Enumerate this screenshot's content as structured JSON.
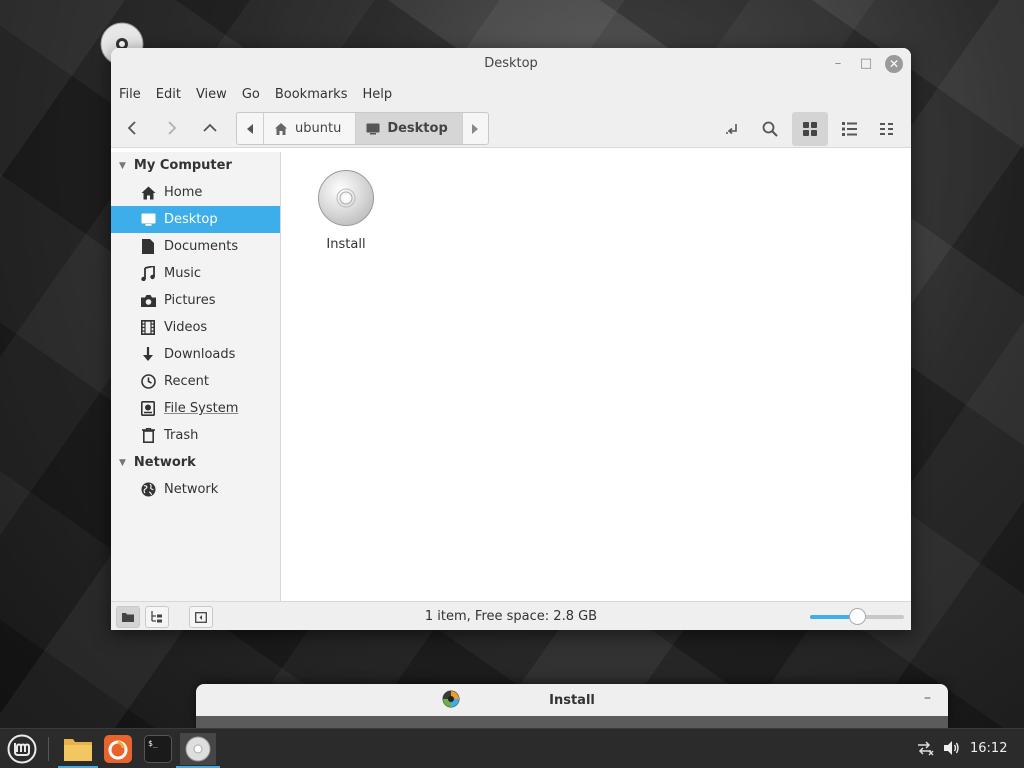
{
  "desktop": {
    "icon_label": "Install"
  },
  "window": {
    "title": "Desktop",
    "controls": {
      "minimize": "–",
      "maximize": "□",
      "close": "✕"
    }
  },
  "menubar": [
    "File",
    "Edit",
    "Go",
    "Bookmarks",
    "Help"
  ],
  "pathbar": {
    "crumbs": [
      {
        "label": "ubuntu",
        "icon": "home-icon"
      },
      {
        "label": "Desktop",
        "icon": "desktop-icon"
      }
    ]
  },
  "sidebar": {
    "sections": [
      {
        "title": "My Computer",
        "items": [
          {
            "label": "Home",
            "icon": "home-icon"
          },
          {
            "label": "Desktop",
            "icon": "desktop-icon",
            "selected": true
          },
          {
            "label": "Documents",
            "icon": "document-icon"
          },
          {
            "label": "Music",
            "icon": "music-icon"
          },
          {
            "label": "Pictures",
            "icon": "camera-icon"
          },
          {
            "label": "Videos",
            "icon": "film-icon"
          },
          {
            "label": "Downloads",
            "icon": "download-icon"
          },
          {
            "label": "Recent",
            "icon": "clock-icon"
          },
          {
            "label": "File System",
            "icon": "drive-icon"
          },
          {
            "label": "Trash",
            "icon": "trash-icon"
          }
        ]
      },
      {
        "title": "Network",
        "items": [
          {
            "label": "Network",
            "icon": "globe-icon"
          }
        ]
      }
    ]
  },
  "files": [
    {
      "label": "Install",
      "icon": "disc-icon"
    }
  ],
  "statusbar": {
    "text": "1 item, Free space: 2.8 GB",
    "zoom_level": 0.5
  },
  "dialog": {
    "title": "Install",
    "minimize": "–"
  },
  "taskbar": {
    "clock": "16:12"
  },
  "colors": {
    "accent": "#3daee9",
    "window_chrome": "#efefef",
    "taskbar": "#2b2b2b"
  }
}
